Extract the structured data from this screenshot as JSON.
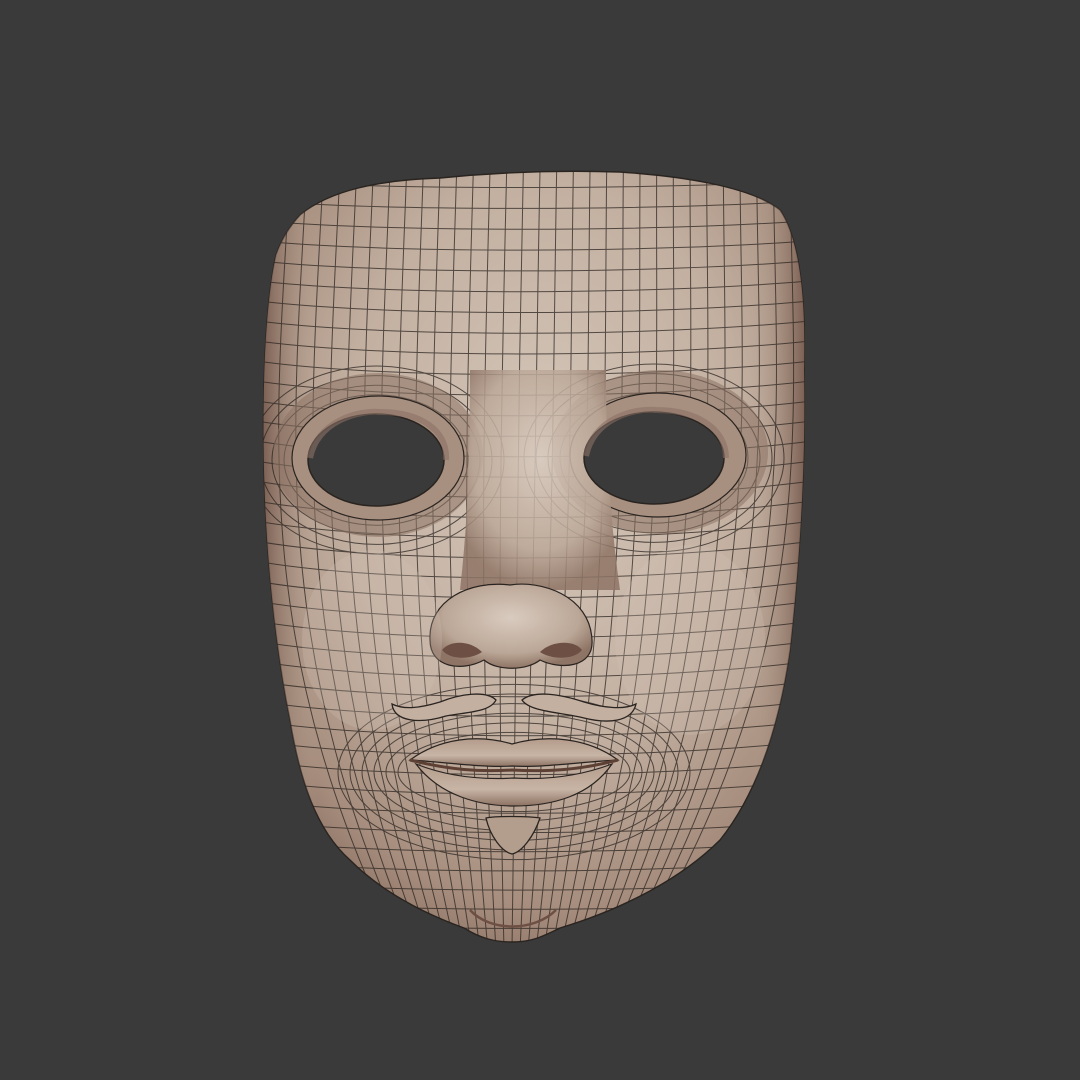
{
  "scene": {
    "background_color": "#3a3a3a",
    "subject": "mask-mesh",
    "colors": {
      "surface_light": "#d2c3b6",
      "surface_mid": "#b7a394",
      "surface_dark": "#8b7265",
      "crease": "#6d4f43",
      "wire": "#2a2420",
      "eye_hole": "#3a3a3a"
    },
    "wireframe": {
      "visible": true
    }
  }
}
